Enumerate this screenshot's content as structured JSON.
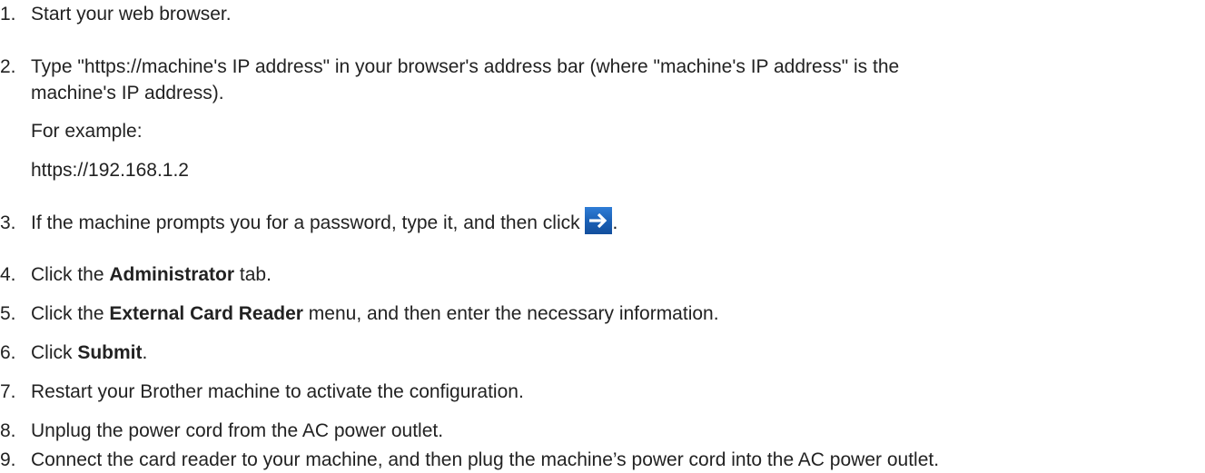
{
  "steps": [
    {
      "num": "1.",
      "pre": "Start your web browser.",
      "bold": "",
      "post": ""
    },
    {
      "num": "2.",
      "pre": "Type \"https://machine's IP address\" in your browser's address bar (where \"machine's IP address\" is the",
      "cont": "machine's IP address).",
      "example_label": "For example:",
      "example_value": "https://192.168.1.2"
    },
    {
      "num": "3.",
      "pre": "If the machine prompts you for a password, type it, and then click",
      "post": "."
    },
    {
      "num": "4.",
      "pre": "Click the ",
      "bold": "Administrator",
      "post": " tab."
    },
    {
      "num": "5.",
      "pre": "Click the ",
      "bold": "External Card Reader",
      "post": " menu, and then enter the necessary information."
    },
    {
      "num": "6.",
      "pre": "Click ",
      "bold": "Submit",
      "post": "."
    },
    {
      "num": "7.",
      "pre": "Restart your Brother machine to activate the configuration.",
      "bold": "",
      "post": ""
    },
    {
      "num": "8.",
      "pre": "Unplug the power cord from the AC power outlet.",
      "bold": "",
      "post": ""
    },
    {
      "num": "9.",
      "pre": "Connect the card reader to your machine, and then plug the machine’s power cord into the AC power outlet.",
      "bold": "",
      "post": ""
    }
  ],
  "icons": {
    "login_arrow": "arrow-right-icon",
    "login_arrow_color": "#1a5fb4"
  }
}
